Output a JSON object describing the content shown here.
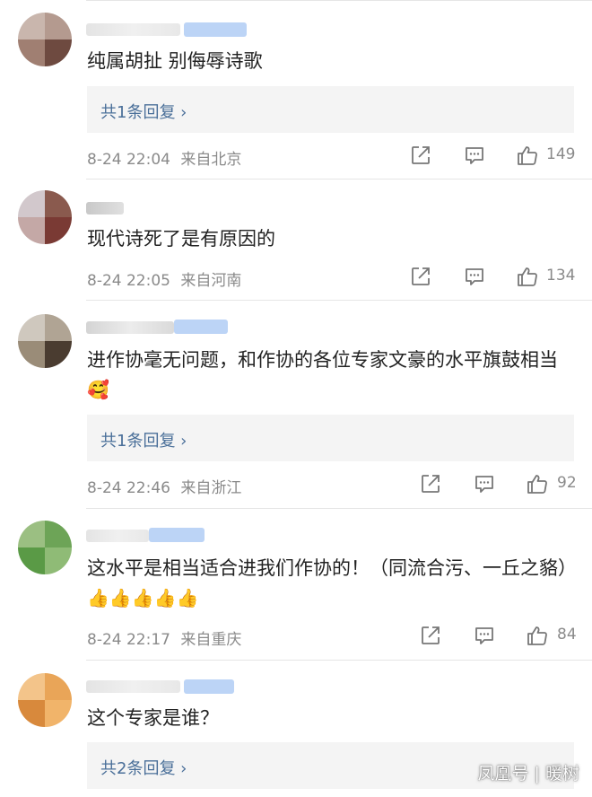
{
  "comments": [
    {
      "text": "纯属胡扯 别侮辱诗歌",
      "reply": "共1条回复 ›",
      "time": "8-24 22:04",
      "location": "来自北京",
      "likes": "149"
    },
    {
      "text": "现代诗死了是有原因的",
      "time": "8-24 22:05",
      "location": "来自河南",
      "likes": "134"
    },
    {
      "text": "进作协毫无问题，和作协的各位专家文豪的水平旗鼓相当",
      "emoji": "🥰",
      "reply": "共1条回复 ›",
      "time": "8-24 22:46",
      "location": "来自浙江",
      "likes": "92"
    },
    {
      "text": "这水平是相当适合进我们作协的！（同流合污、一丘之貉）",
      "emoji": "👍👍👍👍👍",
      "time": "8-24 22:17",
      "location": "来自重庆",
      "likes": "84"
    },
    {
      "text": "这个专家是谁？",
      "reply": "共2条回复 ›"
    }
  ],
  "icons": {
    "share": "share-icon",
    "comment": "comment-icon",
    "like": "thumbs-up-icon"
  },
  "watermark": "凤凰号 | 暖树"
}
